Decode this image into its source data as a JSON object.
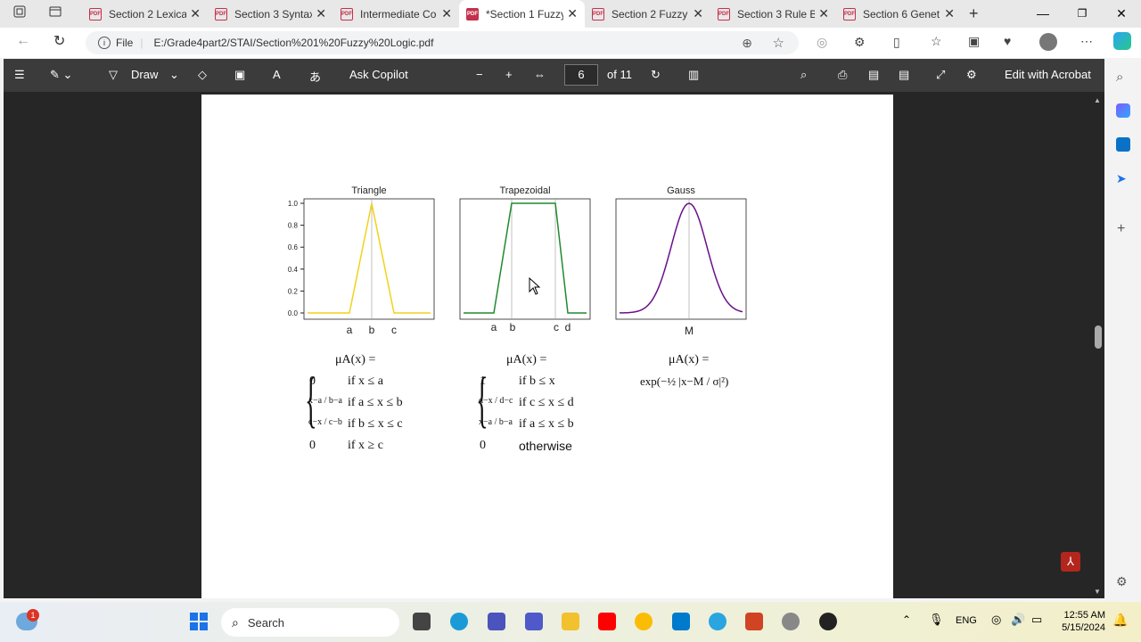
{
  "tabs": [
    {
      "label": "Section 2 Lexica",
      "active": false
    },
    {
      "label": "Section 3 Syntax",
      "active": false
    },
    {
      "label": "Intermediate Co",
      "active": false
    },
    {
      "label": "*Section 1 Fuzzy",
      "active": true
    },
    {
      "label": "Section 2 Fuzzy",
      "active": false
    },
    {
      "label": "Section 3 Rule B",
      "active": false
    },
    {
      "label": "Section 6 Genet",
      "active": false
    }
  ],
  "address": {
    "scheme": "File",
    "url": "E:/Grade4part2/STAI/Section%201%20Fuzzy%20Logic.pdf"
  },
  "pdf_toolbar": {
    "draw": "Draw",
    "ask": "Ask Copilot",
    "page": "6",
    "of": "of 11",
    "edit": "Edit with Acrobat"
  },
  "charts": {
    "triangle": {
      "title": "Triangle",
      "labels": [
        "a",
        "b",
        "c"
      ]
    },
    "trapezoidal": {
      "title": "Trapezoidal",
      "labels": [
        "a",
        "b",
        "c",
        "d"
      ]
    },
    "gauss": {
      "title": "Gauss",
      "labels": [
        "M"
      ]
    },
    "yticks": [
      "0.0",
      "0.2",
      "0.4",
      "0.6",
      "0.8",
      "1.0"
    ]
  },
  "chart_data": [
    {
      "type": "line",
      "title": "Triangle",
      "x": [
        "a",
        "b",
        "c"
      ],
      "y": [
        0,
        1,
        0
      ],
      "ylim": [
        0,
        1
      ],
      "color": "#f2d21b"
    },
    {
      "type": "line",
      "title": "Trapezoidal",
      "x": [
        "a",
        "b",
        "c",
        "d"
      ],
      "y": [
        0,
        1,
        1,
        0
      ],
      "ylim": [
        0,
        1
      ],
      "color": "#1f8a2e"
    },
    {
      "type": "line",
      "title": "Gauss",
      "x": [
        "M"
      ],
      "y": [
        1
      ],
      "ylim": [
        0,
        1
      ],
      "color": "#6a0f8a"
    }
  ],
  "formulas": {
    "lhs": "μA(x) =",
    "tri": [
      [
        "0",
        "if x ≤ a"
      ],
      [
        "x−a / b−a",
        "if a ≤ x ≤ b"
      ],
      [
        "c−x / c−b",
        "if b ≤ x ≤ c"
      ],
      [
        "0",
        "if x ≥ c"
      ]
    ],
    "trap": [
      [
        "1",
        "if b ≤ x"
      ],
      [
        "d−x / d−c",
        "if c ≤ x ≤ d"
      ],
      [
        "x−a / b−a",
        "if a ≤ x ≤ b"
      ],
      [
        "0",
        "otherwise"
      ]
    ],
    "gauss": "exp(−½ |x−M / σ|²)"
  },
  "taskbar": {
    "search": "Search",
    "lang": "ENG",
    "time": "12:55 AM",
    "date": "5/15/2024",
    "weather_badge": "1"
  }
}
